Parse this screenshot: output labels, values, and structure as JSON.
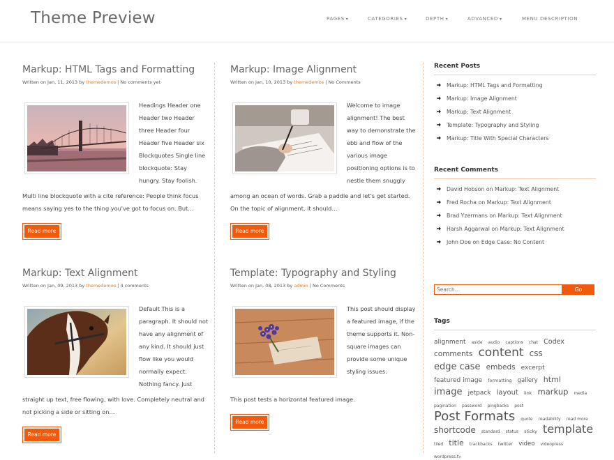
{
  "site": {
    "title": "Theme Preview"
  },
  "nav": [
    {
      "label": "PAGES",
      "caret": "▾"
    },
    {
      "label": "CATEGORIES",
      "caret": "▾"
    },
    {
      "label": "DEPTH",
      "caret": "▾"
    },
    {
      "label": "ADVANCED",
      "caret": "▾"
    },
    {
      "label": "MENU DESCRIPTION",
      "caret": ""
    }
  ],
  "posts": [
    {
      "title": "Markup: HTML Tags and Formatting",
      "written_on": "Written on Jan, 11, 2013 by",
      "author": "themedemos",
      "sep": " | ",
      "comments": "No comments yet",
      "excerpt_side": "Headings Header one Header two Header three Header four Header five Header six Blockquotes Single line blockquote: Stay hungry. Stay foolish.",
      "excerpt_full": "Multi line blockquote with a cite reference: People think focus means saying yes to the thing you've got to focus on. But…",
      "read_more": "Read more",
      "image": "bridge-city-photo"
    },
    {
      "title": "Markup: Image Alignment",
      "written_on": "Written on Jan, 10, 2013 by",
      "author": "themedemos",
      "sep": " | ",
      "comments": "No Comments",
      "excerpt_side": "Welcome to image alignment! The best way to demonstrate the ebb and flow of the various image positioning options is to nestle them snuggly",
      "excerpt_full": "among an ocean of words. Grab a paddle and let's get started. On the topic of alignment, it should…",
      "read_more": "Read more",
      "image": "writing-hand-photo"
    },
    {
      "title": "Markup: Text Alignment",
      "written_on": "Written on Jan, 09, 2013 by",
      "author": "themedemos",
      "sep": " | ",
      "comments": "4 comments",
      "excerpt_side": "Default This is a paragraph. It should not have any alignment of any kind. It should just flow like you would normally expect. Nothing fancy. Just",
      "excerpt_full": "straight up text, free flowing, with love. Completely neutral and not picking a side or sitting on…",
      "read_more": "Read more",
      "image": "horse-photo"
    },
    {
      "title": "Template: Typography and Styling",
      "written_on": "Written on Jan, 08, 2013 by",
      "author": "admin",
      "sep": " | ",
      "comments": "No Comments",
      "excerpt_side": "This post should display a featured image, if the theme supports it. Non-square images can provide some unique styling issues.",
      "excerpt_full": "This post tests a horizontal featured image.",
      "read_more": "Read more",
      "image": "flowers-on-wood-photo"
    }
  ],
  "sidebar": {
    "recent_posts": {
      "title": "Recent Posts",
      "items": [
        "Markup: HTML Tags and Formatting",
        "Markup: Image Alignment",
        "Markup: Text Alignment",
        "Template: Typography and Styling",
        "Markup: Title With Special Characters"
      ]
    },
    "recent_comments": {
      "title": "Recent Comments",
      "on": " on ",
      "items": [
        {
          "author": "David Hobson",
          "post": "Markup: Text Alignment"
        },
        {
          "author": "Fred Rocha",
          "post": "Markup: Text Alignment"
        },
        {
          "author": "Brad Yzermans",
          "post": "Markup: Text Alignment"
        },
        {
          "author": "Harsh Aggarwal",
          "post": "Markup: Text Alignment"
        },
        {
          "author": "John Doe",
          "post": "Edge Case: No Content"
        }
      ]
    },
    "search": {
      "placeholder": "Search…",
      "button": "Go"
    },
    "tags": {
      "title": "Tags",
      "items": [
        {
          "label": "alignment",
          "size": 9
        },
        {
          "label": "aside",
          "size": 6
        },
        {
          "label": "audio",
          "size": 6
        },
        {
          "label": "captions",
          "size": 6
        },
        {
          "label": "chat",
          "size": 6
        },
        {
          "label": "Codex",
          "size": 9.5
        },
        {
          "label": "comments",
          "size": 10.5
        },
        {
          "label": "content",
          "size": 17
        },
        {
          "label": "css",
          "size": 12
        },
        {
          "label": "edge case",
          "size": 13
        },
        {
          "label": "embeds",
          "size": 10.5
        },
        {
          "label": "excerpt",
          "size": 9
        },
        {
          "label": "featured image",
          "size": 9
        },
        {
          "label": "formatting",
          "size": 6.5
        },
        {
          "label": "gallery",
          "size": 8.5
        },
        {
          "label": "html",
          "size": 11
        },
        {
          "label": "image",
          "size": 13
        },
        {
          "label": "jetpack",
          "size": 9
        },
        {
          "label": "layout",
          "size": 10
        },
        {
          "label": "link",
          "size": 6.5
        },
        {
          "label": "markup",
          "size": 11.5
        },
        {
          "label": "media",
          "size": 6
        },
        {
          "label": "pagination",
          "size": 6
        },
        {
          "label": "password",
          "size": 6
        },
        {
          "label": "pingbacks",
          "size": 6
        },
        {
          "label": "post",
          "size": 6
        },
        {
          "label": "Post Formats",
          "size": 18
        },
        {
          "label": "quote",
          "size": 6
        },
        {
          "label": "readability",
          "size": 6
        },
        {
          "label": "read more",
          "size": 6
        },
        {
          "label": "shortcode",
          "size": 12
        },
        {
          "label": "standard",
          "size": 6
        },
        {
          "label": "status",
          "size": 6
        },
        {
          "label": "sticky",
          "size": 6.5
        },
        {
          "label": "template",
          "size": 16
        },
        {
          "label": "tiled",
          "size": 6
        },
        {
          "label": "title",
          "size": 11
        },
        {
          "label": "trackbacks",
          "size": 6
        },
        {
          "label": "twitter",
          "size": 6.5
        },
        {
          "label": "video",
          "size": 8.5
        },
        {
          "label": "videopress",
          "size": 6
        },
        {
          "label": "wordpress.tv",
          "size": 6
        }
      ]
    }
  },
  "colors": {
    "accent": "#f15a0c",
    "link": "#e8761e",
    "divider": "#f3c7a8"
  }
}
